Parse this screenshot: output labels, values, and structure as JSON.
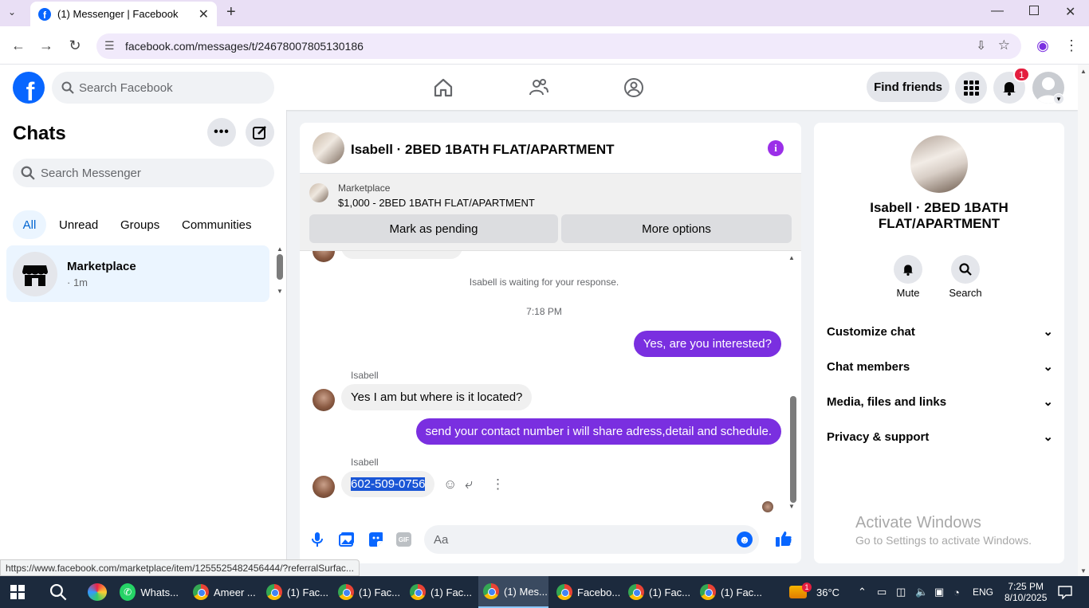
{
  "browser": {
    "tab_title": "(1) Messenger | Facebook",
    "url": "facebook.com/messages/t/24678007805130186",
    "status_url": "https://www.facebook.com/marketplace/item/1255525482456444/?referralSurfac..."
  },
  "fb_header": {
    "search_placeholder": "Search Facebook",
    "find_friends": "Find friends",
    "notification_count": "1"
  },
  "sidebar": {
    "title": "Chats",
    "search_placeholder": "Search Messenger",
    "filters": [
      "All",
      "Unread",
      "Groups",
      "Communities"
    ],
    "active_filter": "All",
    "chat_item": {
      "name": "Marketplace",
      "time": "· 1m"
    }
  },
  "conversation": {
    "title": "Isabell · 2BED 1BATH FLAT/APARTMENT",
    "marketplace_label": "Marketplace",
    "listing": "$1,000 - 2BED 1BATH FLAT/APARTMENT",
    "mark_pending": "Mark as pending",
    "more_options": "More options",
    "waiting_notice": "Isabell is waiting for your response.",
    "timestamp": "7:18 PM",
    "messages": [
      {
        "from": "me",
        "text": "Yes, are you interested?"
      },
      {
        "from": "Isabell",
        "sender_label": "Isabell",
        "text": "Yes I am but where is it located?"
      },
      {
        "from": "me",
        "text": "send your contact number i will share adress,detail and schedule."
      },
      {
        "from": "Isabell",
        "sender_label": "Isabell",
        "text": "602-509-0756"
      }
    ],
    "composer_placeholder": "Aa"
  },
  "right_panel": {
    "name_line1": "Isabell · 2BED 1BATH",
    "name_line2": "FLAT/APARTMENT",
    "mute_label": "Mute",
    "search_label": "Search",
    "sections": [
      "Customize chat",
      "Chat members",
      "Media, files and links",
      "Privacy & support"
    ],
    "watermark_title": "Activate Windows",
    "watermark_sub": "Go to Settings to activate Windows."
  },
  "taskbar": {
    "items": [
      "Whats...",
      "Ameer ...",
      "(1) Fac...",
      "(1) Fac...",
      "(1) Fac...",
      "(1) Mes...",
      "Facebo...",
      "(1) Fac...",
      "(1) Fac..."
    ],
    "weather": "36°C",
    "weather_badge": "1",
    "language": "ENG",
    "time": "7:25 PM",
    "date": "8/10/2025"
  },
  "colors": {
    "fb_blue": "#0866ff",
    "sent_bubble": "#7a2fe0",
    "badge_red": "#e41e3f"
  }
}
